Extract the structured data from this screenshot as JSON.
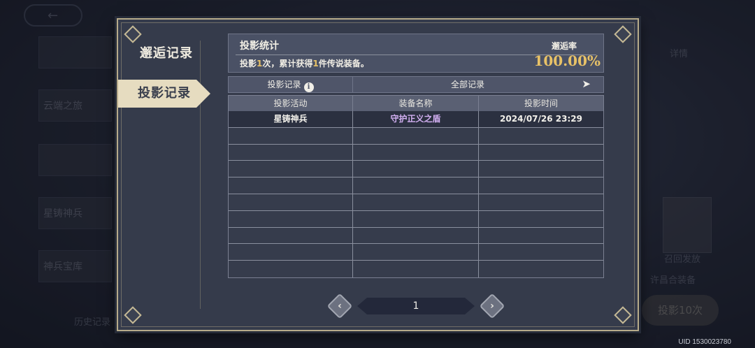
{
  "background": {
    "left_cards": [
      "云端之旅",
      "星铸神兵",
      "神兵宝库"
    ],
    "right_items": [
      "详情",
      "召回发放",
      "许昌合装备"
    ],
    "history_label": "历史记录",
    "summon_button": "投影10次",
    "uid": "UID 1530023780"
  },
  "sidenav": {
    "items": [
      {
        "label": "邂逅记录"
      },
      {
        "label": "投影记录"
      }
    ]
  },
  "stats": {
    "title": "投影统计",
    "desc_prefix": "投影",
    "count": "1",
    "desc_mid": "次，累计获得",
    "legend_count": "1",
    "desc_suffix": "件传说装备。",
    "rate_label": "邂逅率",
    "rate_value": "100.00%"
  },
  "filter": {
    "label": "投影记录",
    "info_icon": "i",
    "selected": "全部记录",
    "chevron": "›"
  },
  "table": {
    "headers": [
      "投影活动",
      "装备名称",
      "投影时间"
    ],
    "rows": [
      {
        "activity": "星铸神兵",
        "item": "守护正义之盾",
        "time": "2024/07/26 23:29"
      }
    ],
    "empty_rows": 9
  },
  "pager": {
    "prev": "‹",
    "page": "1",
    "next": "›"
  },
  "colors": {
    "gold": "#e8c267",
    "item_purple": "#d3b0f2",
    "panel": "#353b4b",
    "border": "#b7ab8a"
  }
}
